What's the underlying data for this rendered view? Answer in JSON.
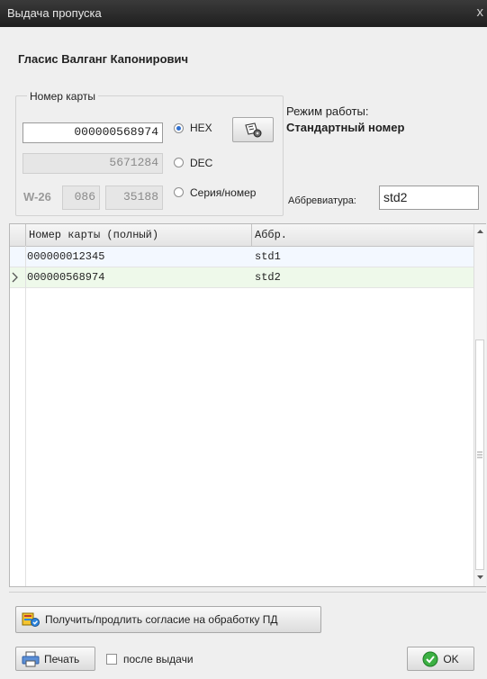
{
  "window": {
    "title": "Выдача пропуска",
    "close_glyph": "x"
  },
  "person": {
    "name": "Гласис Валганг Капонирович"
  },
  "card_group": {
    "label": "Номер карты",
    "hex_value": "000000568974",
    "dec_value": "5671284",
    "w26_label": "W-26",
    "series_value": "086",
    "number_value": "35188",
    "radios": [
      {
        "label": "HEX",
        "selected": true
      },
      {
        "label": "DEC",
        "selected": false
      },
      {
        "label": "Серия/номер",
        "selected": false
      }
    ],
    "action_icon": "card-settings-icon"
  },
  "mode": {
    "title": "Режим работы:",
    "value": "Стандартный номер",
    "abbr_label": "Аббревиатура:",
    "abbr_value": "std2"
  },
  "table": {
    "columns": [
      "Номер карты (полный)",
      "Аббр."
    ],
    "rows": [
      {
        "card": "000000012345",
        "abbr": "std1",
        "current": false
      },
      {
        "card": "000000568974",
        "abbr": "std2",
        "current": true
      }
    ]
  },
  "consent_button": {
    "label": "Получить/продлить согласие на обработку ПД",
    "icon": "consent-icon"
  },
  "print_button": {
    "label": "Печать",
    "icon": "printer-icon"
  },
  "after_issue_checkbox": {
    "label": "после выдачи",
    "checked": false
  },
  "ok_button": {
    "label": "OK",
    "icon": "check-circle-icon"
  },
  "colors": {
    "titlebar": "#2a2a2a",
    "background": "#efefef",
    "current_row": "#eef9ea",
    "accent": "#2f6fd0"
  }
}
